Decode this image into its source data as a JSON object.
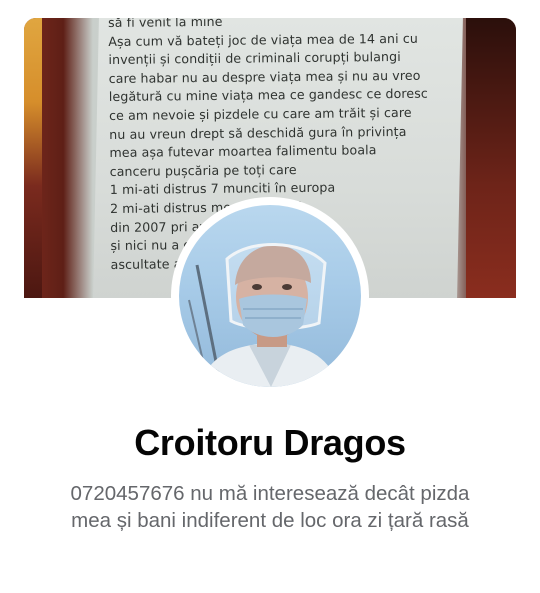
{
  "cover": {
    "lines": [
      "să fi venit la mine",
      "Așa cum vă bateți joc de viața mea de 14 ani cu",
      "invenții și condiții de criminali corupți bulangi",
      "care habar nu au despre viața mea și nu au vreo",
      "legătură cu mine viața mea ce gandesc ce doresc",
      "ce am nevoie și pizdele cu care am trăit și care",
      "nu au vreun drept să deschidă gura în privința",
      "mea așa futevar moartea falimentu boala",
      "canceru pușcăria pe toți care",
      "1 mi-ati distrus 7 munciti în europa",
      "2 mi-ati distrus                 mea și cu silvia",
      "din 2007 pri                       avut muncă",
      "și nici nu a                          oane",
      "ascultate                           acat la tot"
    ]
  },
  "profile": {
    "name": "Croitoru Dragos",
    "bio": "0720457676 nu mă interesează decât pizda mea și bani indiferent de loc ora zi țară rasă"
  }
}
